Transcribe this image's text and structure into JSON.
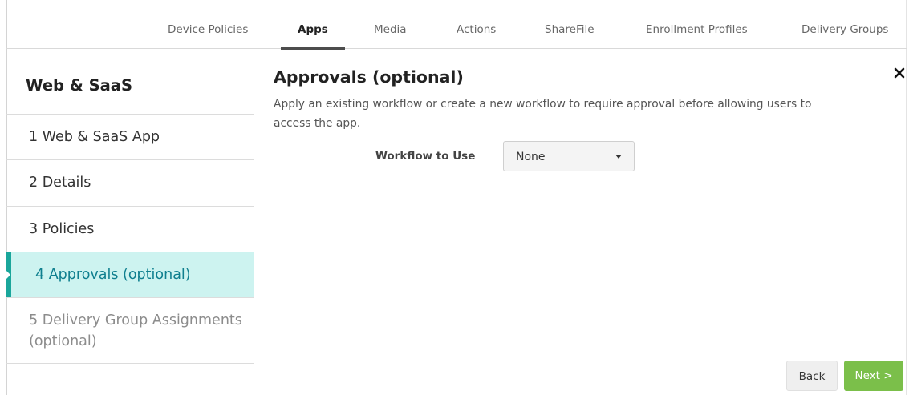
{
  "topnav": {
    "tabs": [
      {
        "label": "Device Policies",
        "active": false
      },
      {
        "label": "Apps",
        "active": true
      },
      {
        "label": "Media",
        "active": false
      },
      {
        "label": "Actions",
        "active": false
      },
      {
        "label": "ShareFile",
        "active": false
      },
      {
        "label": "Enrollment Profiles",
        "active": false
      },
      {
        "label": "Delivery Groups",
        "active": false
      }
    ]
  },
  "sidebar": {
    "title": "Web & SaaS",
    "steps": [
      {
        "label": "1  Web & SaaS App",
        "state": "done"
      },
      {
        "label": "2  Details",
        "state": "done"
      },
      {
        "label": "3  Policies",
        "state": "done"
      },
      {
        "label": "4  Approvals (optional)",
        "state": "active"
      },
      {
        "label_line1": "5  Delivery Group Assignments",
        "label_line2": "(optional)",
        "state": "pending"
      }
    ]
  },
  "main": {
    "title": "Approvals (optional)",
    "description": "Apply an existing workflow or create a new workflow to require approval before allowing users to access the app.",
    "workflow_label": "Workflow to Use",
    "workflow_value": "None",
    "close_icon": "close-icon"
  },
  "footer": {
    "back_label": "Back",
    "next_label": "Next >"
  },
  "colors": {
    "active_step_bg": "#cdf3f0",
    "active_step_border": "#1aa69b",
    "next_button": "#7bbf4a"
  }
}
